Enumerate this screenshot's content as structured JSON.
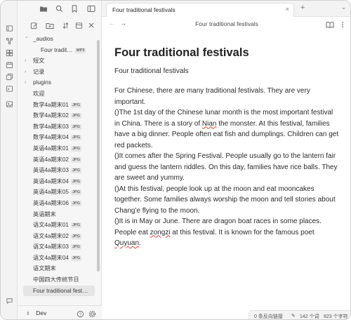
{
  "ribbon": {
    "icons": [
      "sidebar-folder-icon",
      "graph-icon",
      "grid-icon",
      "calendar-icon",
      "copy-icon",
      "terminal-icon",
      "chat-icon",
      "question-icon",
      "settings-icon"
    ]
  },
  "sidebar": {
    "top_icons": [
      "folder-icon",
      "search-icon",
      "bookmark-icon",
      "sidebar-toggle-icon"
    ],
    "toolbar_icons": [
      "new-note-icon",
      "new-folder-icon",
      "sort-icon",
      "collapse-icon",
      "close-icon"
    ],
    "tree": [
      {
        "label": "_audios",
        "type": "folder-open"
      },
      {
        "label": "Four tradit…",
        "type": "file",
        "badge": "MP3",
        "child": true
      },
      {
        "label": "短文",
        "type": "folder"
      },
      {
        "label": "记录",
        "type": "folder"
      },
      {
        "label": "plugins",
        "type": "folder"
      },
      {
        "label": "欢迎",
        "type": "file"
      },
      {
        "label": "数学4a期末01",
        "type": "file",
        "badge": "JPG"
      },
      {
        "label": "数学4a期末02",
        "type": "file",
        "badge": "JPG"
      },
      {
        "label": "数学4a期末03",
        "type": "file",
        "badge": "JPG"
      },
      {
        "label": "数学4a期末04",
        "type": "file",
        "badge": "JPG"
      },
      {
        "label": "英语4a期末01",
        "type": "file",
        "badge": "JPG"
      },
      {
        "label": "英语4a期末02",
        "type": "file",
        "badge": "JPG"
      },
      {
        "label": "英语4a期末03",
        "type": "file",
        "badge": "JPG"
      },
      {
        "label": "英语4a期末04",
        "type": "file",
        "badge": "JPG"
      },
      {
        "label": "英语4a期末05",
        "type": "file",
        "badge": "JPG"
      },
      {
        "label": "英语4a期末06",
        "type": "file",
        "badge": "JPG"
      },
      {
        "label": "英语期末",
        "type": "file"
      },
      {
        "label": "语文4a期末01",
        "type": "file",
        "badge": "JPG"
      },
      {
        "label": "语文4a期末02",
        "type": "file",
        "badge": "JPG"
      },
      {
        "label": "语文4a期末03",
        "type": "file",
        "badge": "JPG"
      },
      {
        "label": "语文4a期末04",
        "type": "file",
        "badge": "JPG"
      },
      {
        "label": "语文期末",
        "type": "file"
      },
      {
        "label": "中国四大传统节日",
        "type": "file"
      },
      {
        "label": "Four traditional fest…",
        "type": "file",
        "active": true
      }
    ],
    "footer": {
      "vault_name": "Dev"
    }
  },
  "tabs": [
    {
      "title": "Four traditional festivals",
      "close": "×"
    }
  ],
  "new_tab_glyph": "+",
  "nav": {
    "back": "←",
    "forward": "→",
    "breadcrumb": "Four traditional festivals"
  },
  "document": {
    "title": "Four traditional festivals",
    "subtitle": "Four traditional festivals",
    "paragraphs": [
      {
        "parts": [
          {
            "t": "For Chinese, there are many traditional festivals. They are very important."
          }
        ]
      },
      {
        "parts": [
          {
            "t": "()The 1st day of the Chinese lunar month is the most important festival in China. There is a story of "
          },
          {
            "t": "Nian",
            "sp": true
          },
          {
            "t": " the monster. At this festival, families have a big dinner. People often eat fish and dumplings. Children can get red packets."
          }
        ]
      },
      {
        "parts": [
          {
            "t": "()It comes after the Spring Festival. People usually go to the lantern fair and guess the lantern riddles. On this day, families have rice balls. They are sweet and yummy."
          }
        ]
      },
      {
        "parts": [
          {
            "t": "()At this festival, people look up at the moon and eat mooncakes together. Some families always worship the moon and tell stories about Chang'e flying to the moon."
          }
        ]
      },
      {
        "parts": [
          {
            "t": "()It is in May or June. There are dragon boat races in some places. People eat "
          },
          {
            "t": "zongzi",
            "sp": true
          },
          {
            "t": " at this festival. It is known for the famous poet "
          },
          {
            "t": "Quyuan",
            "sp": true
          },
          {
            "t": "."
          }
        ]
      }
    ]
  },
  "status": {
    "backlinks": "0 条反向链接",
    "words": "142 个词",
    "chars": "823 个字符"
  },
  "colors": {
    "accent": "#7b6cd9",
    "sidebar_bg": "#f6f6f6",
    "ribbon_bg": "#f3f3f3"
  }
}
